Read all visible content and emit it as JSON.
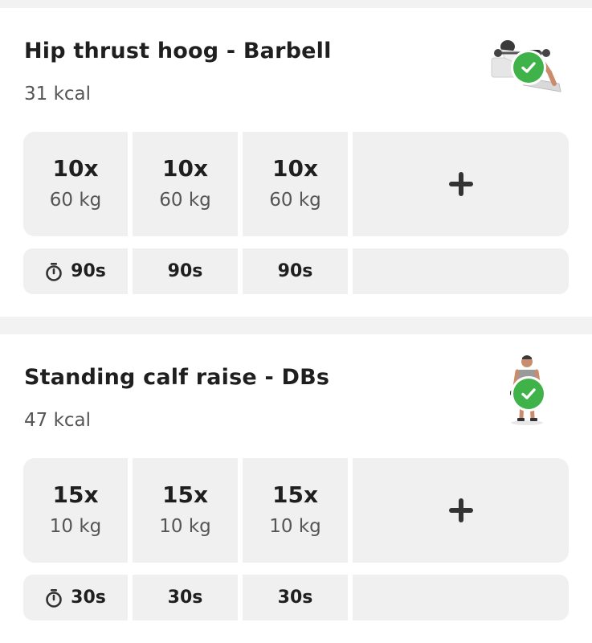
{
  "exercises": [
    {
      "name": "Hip thrust hoog - Barbell",
      "calories": "31 kcal",
      "thumbnail_icon": "hip-thrust-figure",
      "status_icon": "check-icon",
      "sets": [
        {
          "reps": "10x",
          "weight": "60 kg",
          "rest": "90s"
        },
        {
          "reps": "10x",
          "weight": "60 kg",
          "rest": "90s"
        },
        {
          "reps": "10x",
          "weight": "60 kg",
          "rest": "90s"
        }
      ],
      "add_label": "+"
    },
    {
      "name": "Standing calf raise - DBs",
      "calories": "47 kcal",
      "thumbnail_icon": "calf-raise-figure",
      "status_icon": "check-icon",
      "sets": [
        {
          "reps": "15x",
          "weight": "10 kg",
          "rest": "30s"
        },
        {
          "reps": "15x",
          "weight": "10 kg",
          "rest": "30s"
        },
        {
          "reps": "15x",
          "weight": "10 kg",
          "rest": "30s"
        }
      ],
      "add_label": "+"
    }
  ],
  "colors": {
    "check": "#3fb24a",
    "cell_background": "#f0f0f0",
    "page_background": "#f2f2f2"
  }
}
